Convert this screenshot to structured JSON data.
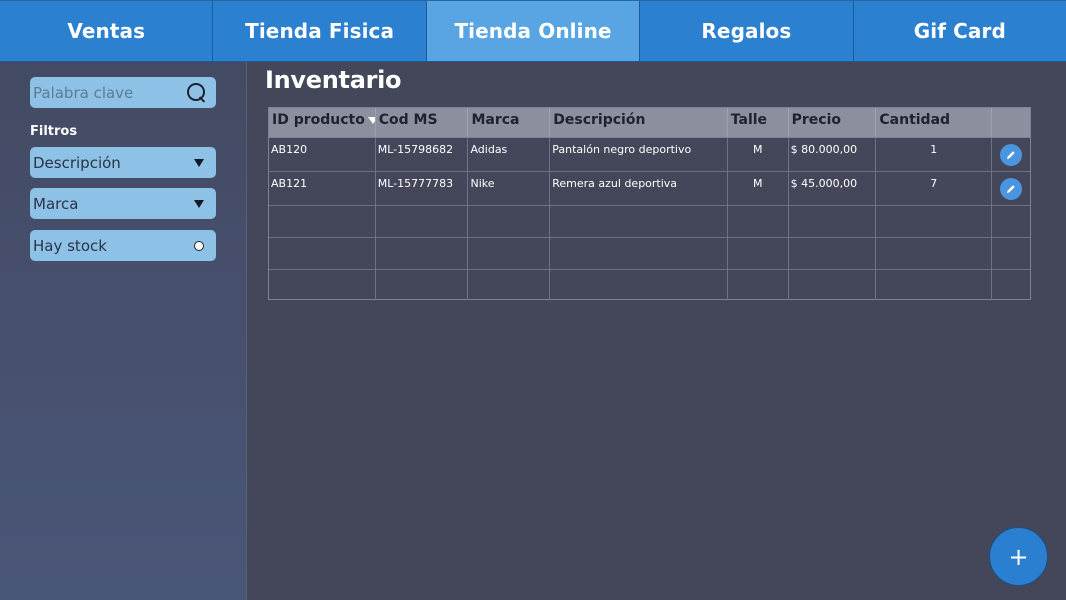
{
  "nav": {
    "tabs": [
      {
        "label": "Ventas"
      },
      {
        "label": "Tienda Fisica"
      },
      {
        "label": "Tienda Online",
        "active": true
      },
      {
        "label": "Regalos"
      },
      {
        "label": "Gif Card"
      }
    ]
  },
  "sidebar": {
    "search_placeholder": "Palabra clave",
    "filters_title": "Filtros",
    "filters": [
      {
        "label": "Descripción",
        "icon": "dropdown-caret-icon"
      },
      {
        "label": "Marca",
        "icon": "dropdown-caret-icon"
      },
      {
        "label": "Hay stock",
        "icon": "radio-icon"
      }
    ]
  },
  "main": {
    "title": "Inventario",
    "table": {
      "headers": [
        "ID producto",
        "Cod MS",
        "Marca",
        "Descripción",
        "Talle",
        "Precio",
        "Cantidad",
        ""
      ],
      "rows": [
        {
          "id": "AB120",
          "cod_ms": "ML-15798682",
          "marca": "Adidas",
          "descripcion": "Pantalón negro deportivo",
          "talle": "M",
          "precio": "$ 80.000,00",
          "cantidad": "1"
        },
        {
          "id": "AB121",
          "cod_ms": "ML-15777783",
          "marca": "Nike",
          "descripcion": "Remera azul deportiva",
          "talle": "M",
          "precio": "$ 45.000,00",
          "cantidad": "7"
        }
      ]
    },
    "fab_label": "+"
  },
  "colors": {
    "nav_bg": "#2b80cf",
    "nav_active": "#59a5e3",
    "field_bg": "#8ec1e6",
    "page_bg": "#434759",
    "table_header": "#8b8f9e"
  }
}
